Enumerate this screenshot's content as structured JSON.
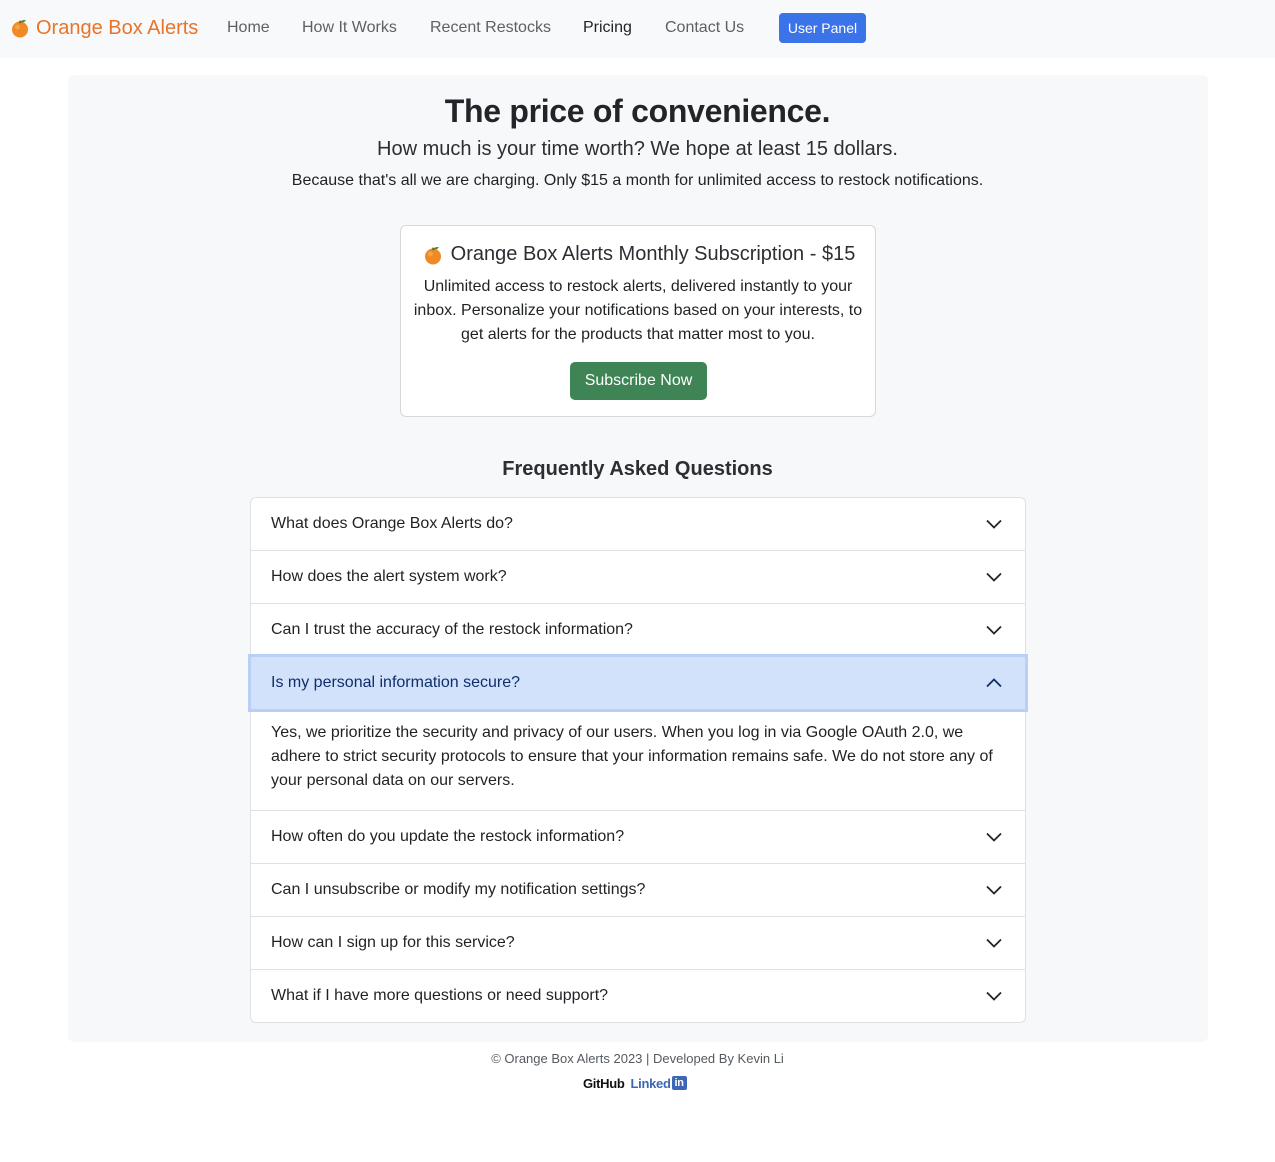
{
  "navbar": {
    "brand": "Orange Box Alerts",
    "links": [
      "Home",
      "How It Works",
      "Recent Restocks",
      "Pricing",
      "Contact Us"
    ],
    "active": "Pricing",
    "user_panel": "User Panel"
  },
  "hero": {
    "title": "The price of convenience.",
    "subtitle": "How much is your time worth? We hope at least 15 dollars.",
    "note": "Because that's all we are charging. Only $15 a month for unlimited access to restock notifications."
  },
  "subscription": {
    "title": "Orange Box Alerts Monthly Subscription - $15",
    "description": "Unlimited access to restock alerts, delivered instantly to your inbox. Personalize your notifications based on your interests, to get alerts for the products that matter most to you.",
    "button": "Subscribe Now"
  },
  "faq": {
    "title": "Frequently Asked Questions",
    "items": [
      {
        "question": "What does Orange Box Alerts do?",
        "open": false
      },
      {
        "question": "How does the alert system work?",
        "open": false
      },
      {
        "question": "Can I trust the accuracy of the restock information?",
        "open": false
      },
      {
        "question": "Is my personal information secure?",
        "open": true,
        "answer": "Yes, we prioritize the security and privacy of our users. When you log in via Google OAuth 2.0, we adhere to strict security protocols to ensure that your information remains safe. We do not store any of your personal data on our servers."
      },
      {
        "question": "How often do you update the restock information?",
        "open": false
      },
      {
        "question": "Can I unsubscribe or modify my notification settings?",
        "open": false
      },
      {
        "question": "How can I sign up for this service?",
        "open": false
      },
      {
        "question": "What if I have more questions or need support?",
        "open": false
      }
    ]
  },
  "footer": {
    "text": "© Orange Box Alerts 2023 | Developed By Kevin Li",
    "github": "GitHub",
    "linkedin_text": "Linked",
    "linkedin_box": "in"
  },
  "colors": {
    "brand": "#e8742a",
    "primary": "#3b73e8",
    "success": "#3e8454",
    "accordion_open_bg": "#d3e2fb"
  },
  "icons": {
    "brand": "orange-fruit-icon",
    "accordion_closed": "chevron-down-icon",
    "accordion_open": "chevron-up-icon"
  }
}
